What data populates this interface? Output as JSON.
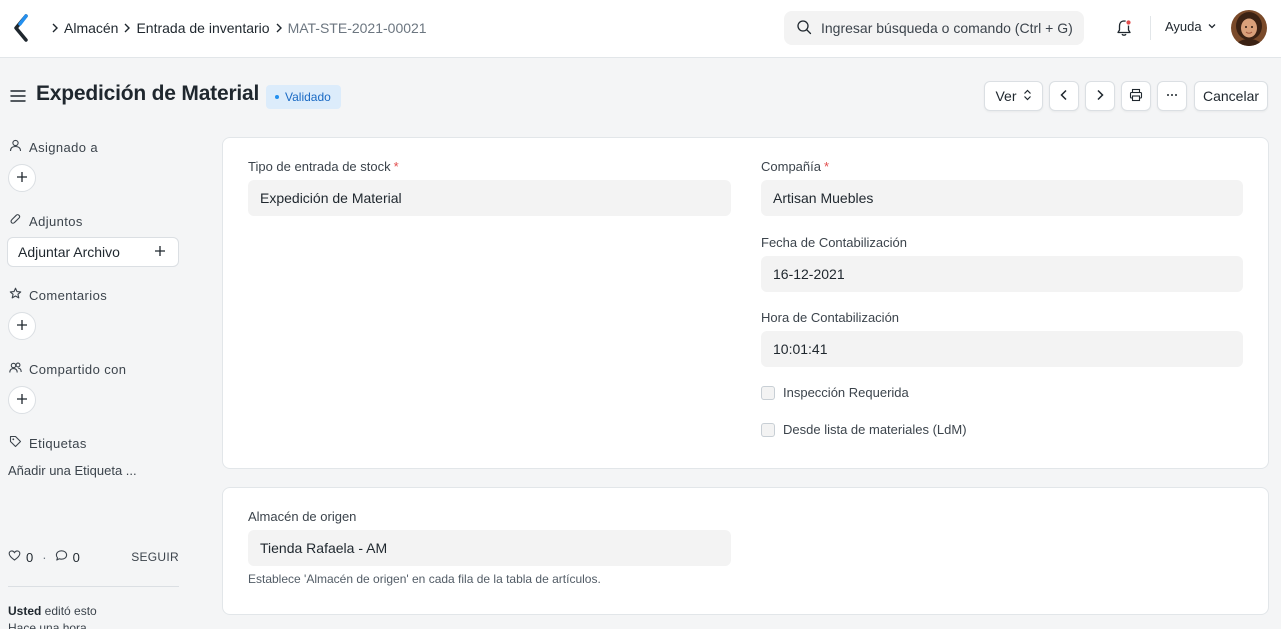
{
  "breadcrumbs": [
    "Almacén",
    "Entrada de inventario",
    "MAT-STE-2021-00021"
  ],
  "search": {
    "placeholder": "Ingresar búsqueda o comando (Ctrl + G)"
  },
  "navbar": {
    "help_label": "Ayuda"
  },
  "page": {
    "title": "Expedición de Material",
    "status": "Validado"
  },
  "actions": {
    "view_label": "Ver",
    "cancel_label": "Cancelar"
  },
  "sidebar": {
    "assigned_label": "Asignado a",
    "attachments_label": "Adjuntos",
    "attach_button": "Adjuntar Archivo",
    "comments_label": "Comentarios",
    "shared_label": "Compartido con",
    "tags_label": "Etiquetas",
    "add_tag": "Añadir una Etiqueta ...",
    "likes": "0",
    "comments_count": "0",
    "follow_label": "SEGUIR",
    "activity_user": "Usted",
    "activity_action": " editó esto",
    "activity_time": "Hace una hora"
  },
  "form": {
    "stock_entry_type": {
      "label": "Tipo de entrada de stock",
      "value": "Expedición de Material"
    },
    "company": {
      "label": "Compañía",
      "value": "Artisan Muebles"
    },
    "posting_date": {
      "label": "Fecha de Contabilización",
      "value": "16-12-2021"
    },
    "posting_time": {
      "label": "Hora de Contabilización",
      "value": "10:01:41"
    },
    "inspection_required": {
      "label": "Inspección Requerida",
      "checked": false
    },
    "from_bom": {
      "label": "Desde lista de materiales (LdM)",
      "checked": false
    },
    "source_warehouse": {
      "label": "Almacén de origen",
      "value": "Tienda Rafaela - AM",
      "help": "Establece 'Almacén de origen' en cada fila de la tabla de artículos."
    }
  },
  "colors": {
    "accent": "#2490ef",
    "badge_bg": "#dcecfb",
    "required": "#e24c4c"
  }
}
